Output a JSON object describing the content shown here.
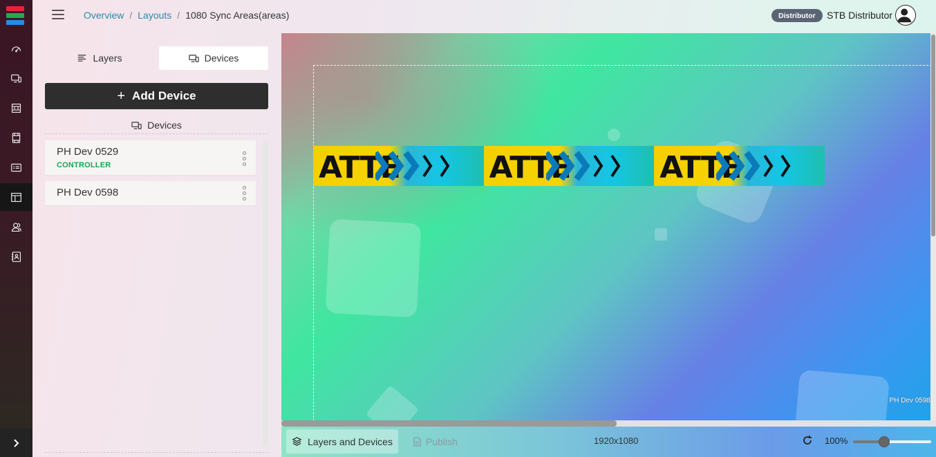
{
  "app": {
    "logo_colors": [
      "#e8213a",
      "#1faa55",
      "#1f8fe5"
    ]
  },
  "nav": {
    "items": [
      {
        "name": "dashboard",
        "icon": "speedometer-icon",
        "active": false
      },
      {
        "name": "devices",
        "icon": "monitor-icon",
        "active": false
      },
      {
        "name": "areas",
        "icon": "frame-icon",
        "active": false
      },
      {
        "name": "media",
        "icon": "film-icon",
        "active": false
      },
      {
        "name": "playlists",
        "icon": "list-screen-icon",
        "active": false
      },
      {
        "name": "layouts",
        "icon": "layout-icon",
        "active": true
      },
      {
        "name": "users",
        "icon": "users-icon",
        "active": false
      },
      {
        "name": "contacts",
        "icon": "contact-book-icon",
        "active": false
      }
    ],
    "expand_icon": "chevron-right-icon"
  },
  "header": {
    "breadcrumb": {
      "overview": "Overview",
      "layouts": "Layouts",
      "current": "1080 Sync Areas(areas)",
      "separator": "/"
    },
    "role_badge": "Distributor",
    "user_name": "STB Distributor"
  },
  "panel": {
    "tabs": {
      "layers": "Layers",
      "devices": "Devices",
      "active": "devices"
    },
    "add_button": {
      "label": "Add Device",
      "icon": "+"
    },
    "devices_heading": "Devices",
    "devices": [
      {
        "name": "PH Dev 0529",
        "role": "CONTROLLER"
      },
      {
        "name": "PH Dev 0598",
        "role": ""
      }
    ]
  },
  "canvas": {
    "banner_text": "ATTE",
    "banner_repeats": 3,
    "area_label": "PH Dev 0598",
    "colors": {
      "banner_yellow": "#f5cf00",
      "banner_cyan": "#14c6e6",
      "selection_border": "#f2f2f2"
    }
  },
  "bottombar": {
    "layers_devices_label": "Layers and Devices",
    "publish_label": "Publish",
    "resolution": "1920x1080",
    "zoom_label": "100%",
    "zoom_value": 0.4
  }
}
